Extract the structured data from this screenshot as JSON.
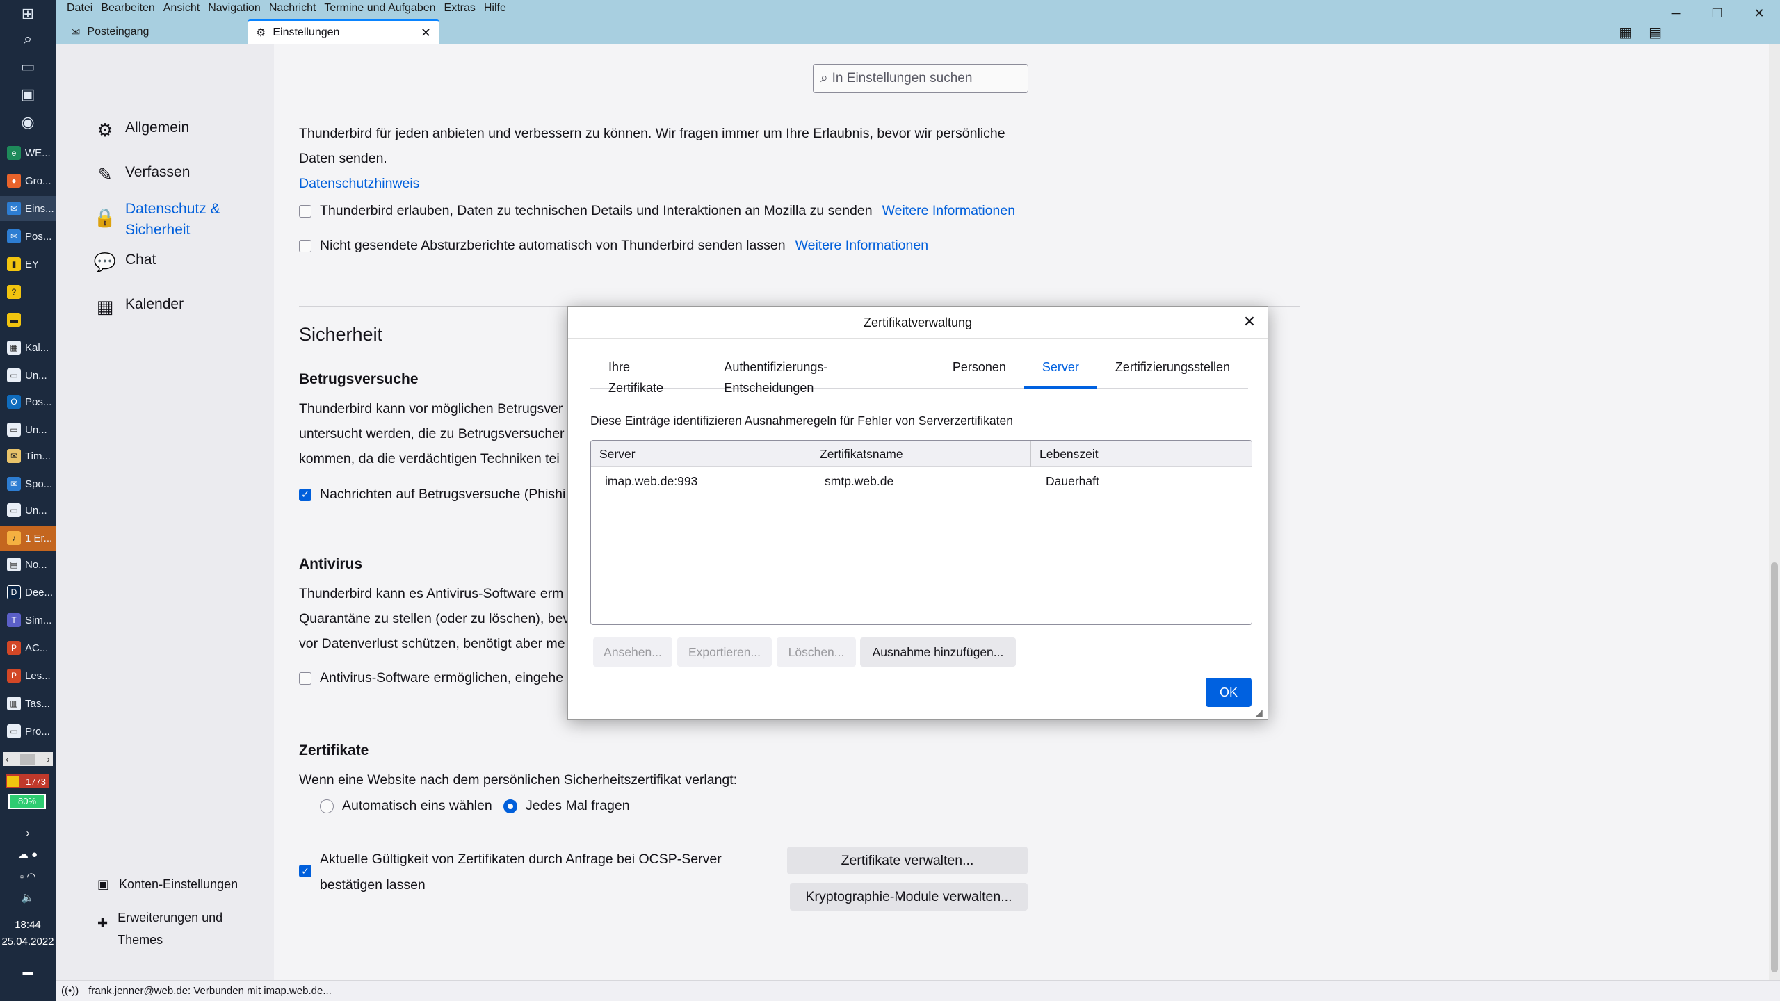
{
  "menu": [
    "Datei",
    "Bearbeiten",
    "Ansicht",
    "Navigation",
    "Nachricht",
    "Termine und Aufgaben",
    "Extras",
    "Hilfe"
  ],
  "tabs": {
    "inbox": "Posteingang",
    "settings": "Einstellungen"
  },
  "taskbar": {
    "items": [
      "WE...",
      "Gro...",
      "Eins...",
      "Pos...",
      "EY",
      "",
      "",
      "Kal...",
      "Un...",
      "Pos...",
      "Un...",
      "Tim...",
      "Spo...",
      "Un...",
      "1 Er...",
      "No...",
      "Dee...",
      "Sim...",
      "AC...",
      "Les...",
      "Tas...",
      "Pro..."
    ],
    "mail_count": "1773",
    "battery": "80%",
    "time": "18:44",
    "date": "25.04.2022"
  },
  "search": {
    "placeholder": "In Einstellungen suchen"
  },
  "sidebar": {
    "categories": [
      "Allgemein",
      "Verfassen",
      "Datenschutz & Sicherheit",
      "Chat",
      "Kalender"
    ],
    "account_settings": "Konten-Einstellungen",
    "addons": "Erweiterungen und Themes"
  },
  "privacy": {
    "intro_line1": "Thunderbird für jeden anbieten und verbessern zu können. Wir fragen immer um Ihre Erlaubnis, bevor wir persönliche",
    "intro_line2": "Daten senden.",
    "privacy_link": "Datenschutzhinweis",
    "telemetry_label": "Thunderbird erlauben, Daten zu technischen Details und Interaktionen an Mozilla zu senden",
    "crash_label": "Nicht gesendete Absturzberichte automatisch von Thunderbird senden lassen",
    "more_info": "Weitere Informationen"
  },
  "security": {
    "heading": "Sicherheit",
    "scam_heading": "Betrugsversuche",
    "scam_line1": "Thunderbird kann vor möglichen Betrugsver",
    "scam_line2": "untersucht werden, die zu Betrugsversucher",
    "scam_line3": "kommen, da die verdächtigen Techniken tei",
    "scam_checkbox": "Nachrichten auf Betrugsversuche (Phishi",
    "antivirus_heading": "Antivirus",
    "antivirus_line1": "Thunderbird kann es Antivirus-Software erm",
    "antivirus_line2": "Quarantäne zu stellen (oder zu löschen), bev",
    "antivirus_line3": "vor Datenverlust schützen, benötigt aber me",
    "antivirus_checkbox": "Antivirus-Software ermöglichen, eingehe",
    "certs_heading": "Zertifikate",
    "certs_desc": "Wenn eine Website nach dem persönlichen Sicherheitszertifikat verlangt:",
    "radio_auto": "Automatisch eins wählen",
    "radio_ask": "Jedes Mal fragen",
    "ocsp_line1": "Aktuelle Gültigkeit von Zertifikaten durch Anfrage bei OCSP-Server",
    "ocsp_line2": "bestätigen lassen",
    "manage_certs": "Zertifikate verwalten...",
    "manage_crypto": "Kryptographie-Module verwalten..."
  },
  "dialog": {
    "title": "Zertifikatverwaltung",
    "tabs": [
      "Ihre Zertifikate",
      "Authentifizierungs-Entscheidungen",
      "Personen",
      "Server",
      "Zertifizierungsstellen"
    ],
    "active_tab": "Server",
    "description": "Diese Einträge identifizieren Ausnahmeregeln für Fehler von Serverzertifikaten",
    "columns": [
      "Server",
      "Zertifikatsname",
      "Lebenszeit"
    ],
    "rows": [
      {
        "server": "imap.web.de:993",
        "cert_name": "smtp.web.de",
        "lifetime": "Dauerhaft"
      }
    ],
    "buttons": {
      "view": "Ansehen...",
      "export": "Exportieren...",
      "delete": "Löschen...",
      "add_exception": "Ausnahme hinzufügen..."
    },
    "ok": "OK"
  },
  "status": {
    "text": "frank.jenner@web.de: Verbunden mit imap.web.de..."
  },
  "colors": {
    "accent": "#0061e0",
    "titlebar": "#a8cfe0",
    "taskbar": "#1c2a3e"
  }
}
